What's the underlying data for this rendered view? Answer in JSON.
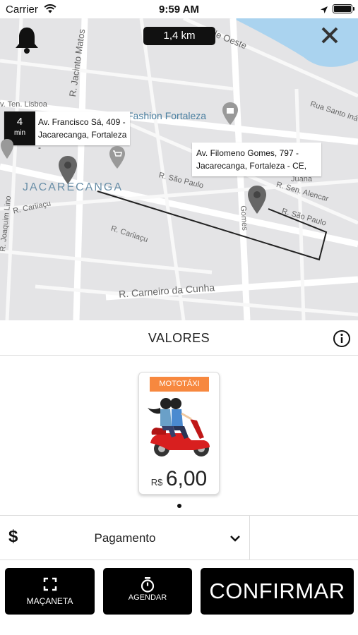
{
  "status_bar": {
    "carrier": "Carrier",
    "time": "9:59 AM"
  },
  "map": {
    "distance": "1,4 km",
    "eta": {
      "value": "4",
      "unit": "min",
      "address": "Av. Francisco Sá, 409 - Jacarecanga, Fortaleza -"
    },
    "destination": {
      "address": "Av. Filomeno Gomes, 797 - Jacarecanga, Fortaleza - CE,"
    },
    "labels": {
      "street1": "R. Jacinto Matos",
      "street2": "de Oeste",
      "street3": "v. Ten. Lisboa",
      "poi": "Fashion Fortaleza",
      "street4": "Rua Santo Iná",
      "neighborhood": "JACARECANGA",
      "street5": "R. São Paulo",
      "street6": "Juana",
      "street7": "R. Sen. Alencar",
      "street8": "R. São Paulo",
      "street9": "R. Cariiaçu",
      "street10": "R. Cariiaçu",
      "street11": "R. Joaquim Lino",
      "street12": "R. Carneiro da Cunha",
      "street13": "Gomes"
    }
  },
  "section": {
    "title": "VALORES"
  },
  "vehicle": {
    "badge": "MOTOTÁXI",
    "currency": "R$",
    "price": "6,00"
  },
  "payment": {
    "label": "Pagamento"
  },
  "buttons": {
    "macaneta": "MAÇANETA",
    "agendar": "AGENDAR",
    "confirm": "CONFIRMAR"
  },
  "icons": [
    "bell-icon",
    "close-icon",
    "map-pin-icon",
    "info-icon",
    "dollar-icon",
    "chevron-down-icon",
    "expand-icon",
    "stopwatch-icon",
    "scooter-icon"
  ]
}
